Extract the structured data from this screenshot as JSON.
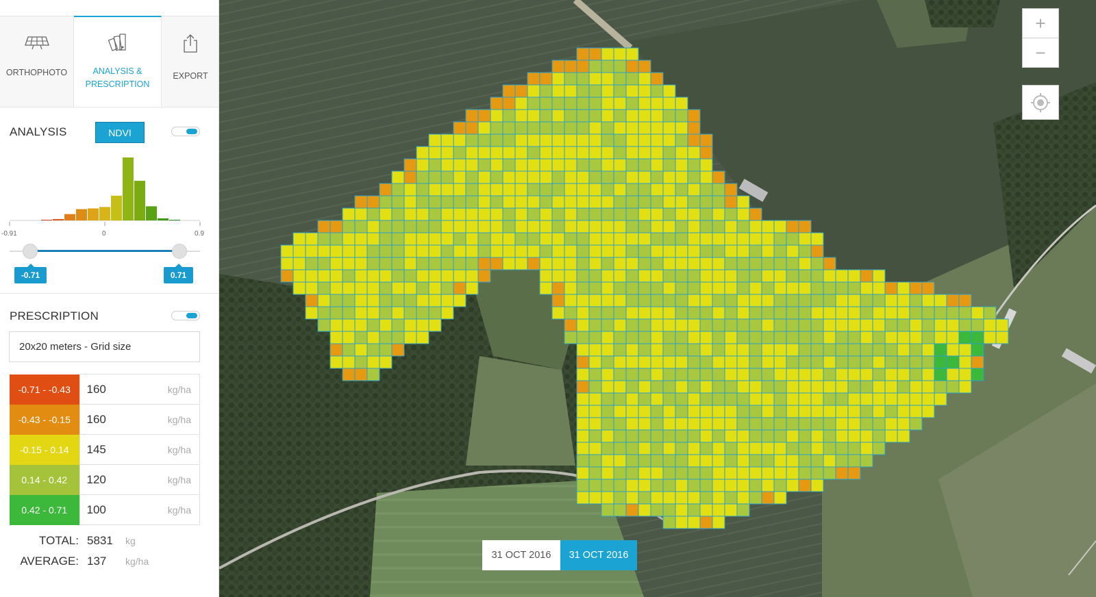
{
  "tabs": {
    "orthophoto": "ORTHOPHOTO",
    "analysis_line1": "ANALYSIS &",
    "analysis_line2": "PRESCRIPTION",
    "export": "EXPORT"
  },
  "analysis": {
    "title": "ANALYSIS",
    "index_button": "NDVI",
    "toggle_on": true,
    "histogram": {
      "bins": [
        1,
        2,
        9,
        16,
        17,
        19,
        35,
        89,
        56,
        20,
        3,
        1
      ],
      "bin_colors": [
        "#d4461e",
        "#dd5a18",
        "#e0801a",
        "#dd8d16",
        "#dda319",
        "#d8b418",
        "#c5bf18",
        "#8fb514",
        "#7aab12",
        "#58a314",
        "#3f9a1a",
        "#2f8e22"
      ],
      "ticks": [
        "-0.91",
        "0",
        "0.9"
      ]
    },
    "range_min": "-0.71",
    "range_max": "0.71"
  },
  "prescription": {
    "title": "PRESCRIPTION",
    "toggle_on": true,
    "grid_size": "20x20 meters - Grid size",
    "rows": [
      {
        "range": "-0.71 - -0.43",
        "value": "160",
        "unit": "kg/ha",
        "color": "#e04e14"
      },
      {
        "range": "-0.43 - -0.15",
        "value": "160",
        "unit": "kg/ha",
        "color": "#e38c12"
      },
      {
        "range": "-0.15 - 0.14",
        "value": "145",
        "unit": "kg/ha",
        "color": "#e3d613"
      },
      {
        "range": "0.14 - 0.42",
        "value": "120",
        "unit": "kg/ha",
        "color": "#a5c33a"
      },
      {
        "range": "0.42 - 0.71",
        "value": "100",
        "unit": "kg/ha",
        "color": "#3cb83a"
      }
    ],
    "total_label": "TOTAL:",
    "total_value": "5831",
    "total_unit": "kg",
    "average_label": "AVERAGE:",
    "average_value": "137",
    "average_unit": "kg/ha"
  },
  "map": {
    "zoom_in": "+",
    "zoom_out": "−",
    "dates": [
      "31 OCT 2016",
      "31 OCT 2016"
    ],
    "active_date_index": 1,
    "zone_colors": {
      "red": "#e04e14",
      "orange": "#e59a12",
      "yellow": "#e2e012",
      "lightgreen": "#a9c83e",
      "green": "#3cb83a"
    },
    "cell_border_color": "#2aa0c8"
  }
}
